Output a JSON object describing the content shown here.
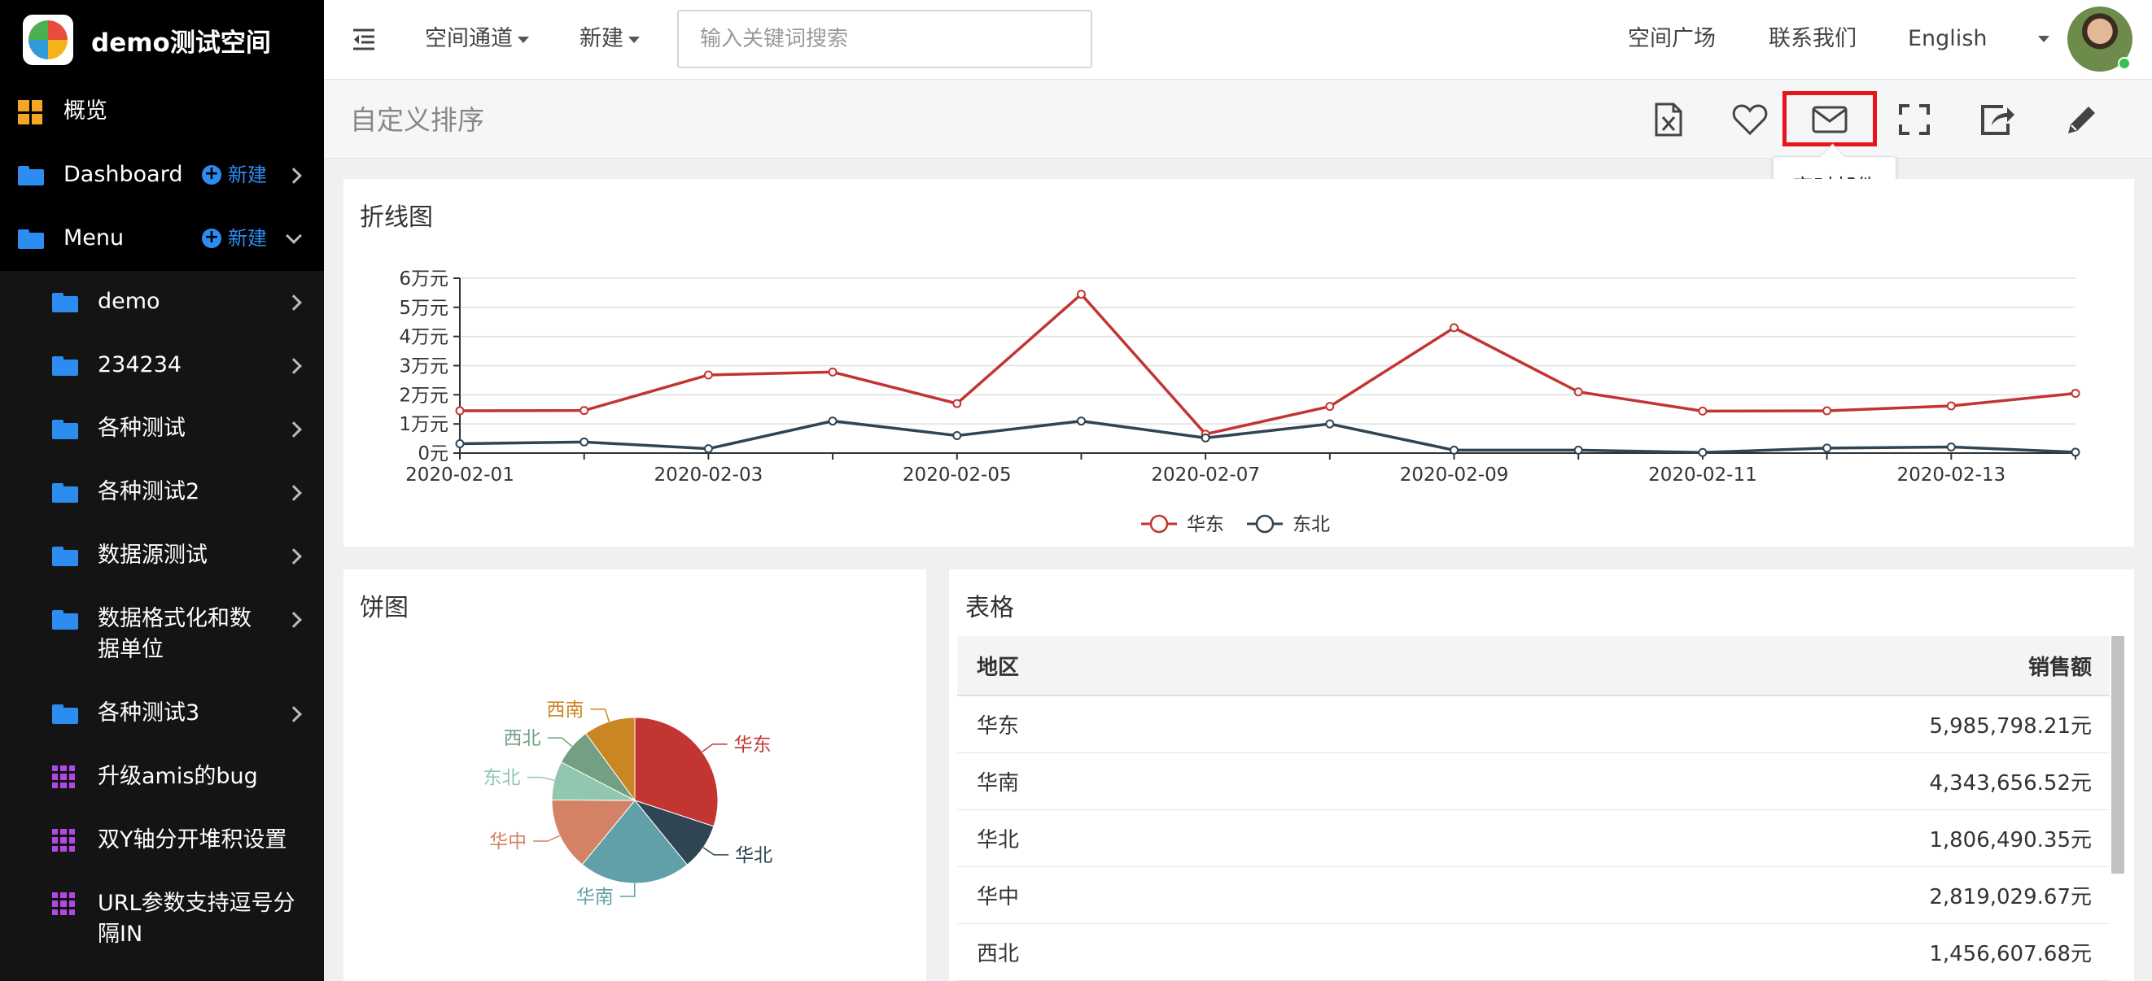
{
  "app": {
    "title": "demo测试空间"
  },
  "sidebar": {
    "overview": "概览",
    "dashboard": {
      "label": "Dashboard",
      "new_label": "新建"
    },
    "menu": {
      "label": "Menu",
      "new_label": "新建"
    },
    "items": [
      {
        "label": "demo",
        "icon": "folder-icon"
      },
      {
        "label": "234234",
        "icon": "folder-icon"
      },
      {
        "label": "各种测试",
        "icon": "folder-icon"
      },
      {
        "label": "各种测试2",
        "icon": "folder-icon"
      },
      {
        "label": "数据源测试",
        "icon": "folder-icon"
      },
      {
        "label": "数据格式化和数",
        "label2": "据单位",
        "icon": "folder-icon"
      },
      {
        "label": "各种测试3",
        "icon": "folder-icon"
      },
      {
        "label": "升级amis的bug",
        "icon": "grid-icon"
      },
      {
        "label": "双Y轴分开堆积设置",
        "icon": "grid-icon"
      },
      {
        "label": "URL参数支持逗号分",
        "label2": "隔IN",
        "icon": "grid-icon"
      }
    ]
  },
  "topbar": {
    "space_channel": "空间通道",
    "new": "新建",
    "search_placeholder": "输入关键词搜索",
    "space_square": "空间广场",
    "contact_us": "联系我们",
    "language": "English"
  },
  "page": {
    "title": "自定义排序",
    "tooltip": "定时邮件"
  },
  "line_chart": {
    "title": "折线图"
  },
  "pie_chart": {
    "title": "饼图"
  },
  "table": {
    "title": "表格",
    "columns": [
      "地区",
      "销售额"
    ],
    "rows": [
      [
        "华东",
        "5,985,798.21元"
      ],
      [
        "华南",
        "4,343,656.52元"
      ],
      [
        "华北",
        "1,806,490.35元"
      ],
      [
        "华中",
        "2,819,029.67元"
      ],
      [
        "西北",
        "1,456,607.68元"
      ]
    ]
  },
  "chart_data": [
    {
      "type": "line",
      "title": "折线图",
      "x": [
        "2020-02-01",
        "2020-02-02",
        "2020-02-03",
        "2020-02-04",
        "2020-02-05",
        "2020-02-06",
        "2020-02-07",
        "2020-02-08",
        "2020-02-09",
        "2020-02-10",
        "2020-02-11",
        "2020-02-12",
        "2020-02-13",
        "2020-02-14"
      ],
      "x_tick_labels": [
        "2020-02-01",
        "2020-02-03",
        "2020-02-05",
        "2020-02-07",
        "2020-02-09",
        "2020-02-11",
        "2020-02-13"
      ],
      "y_tick_labels": [
        "0元",
        "1万元",
        "2万元",
        "3万元",
        "4万元",
        "5万元",
        "6万元"
      ],
      "ylim": [
        0,
        60000
      ],
      "grid": true,
      "legend_position": "bottom",
      "series": [
        {
          "name": "华东",
          "color": "#c23531",
          "values": [
            14500,
            14600,
            26800,
            27800,
            17000,
            54500,
            6500,
            16000,
            43000,
            21000,
            14400,
            14500,
            16200,
            20500
          ]
        },
        {
          "name": "东北",
          "color": "#2f4554",
          "values": [
            3200,
            3800,
            1500,
            11000,
            6000,
            11000,
            5200,
            10000,
            1000,
            1000,
            200,
            1700,
            2100,
            300
          ]
        }
      ]
    },
    {
      "type": "pie",
      "title": "饼图",
      "slices": [
        {
          "name": "华东",
          "value": 5985798.21,
          "color": "#c23531"
        },
        {
          "name": "华北",
          "value": 1806490.35,
          "color": "#2f4554"
        },
        {
          "name": "华南",
          "value": 4343656.52,
          "color": "#61a0a8"
        },
        {
          "name": "华中",
          "value": 2819029.67,
          "color": "#d48265"
        },
        {
          "name": "东北",
          "value": 1500000,
          "color": "#91c7ae"
        },
        {
          "name": "西北",
          "value": 1456607.68,
          "color": "#749f83"
        },
        {
          "name": "西南",
          "value": 2000000,
          "color": "#ca8622"
        }
      ]
    }
  ]
}
